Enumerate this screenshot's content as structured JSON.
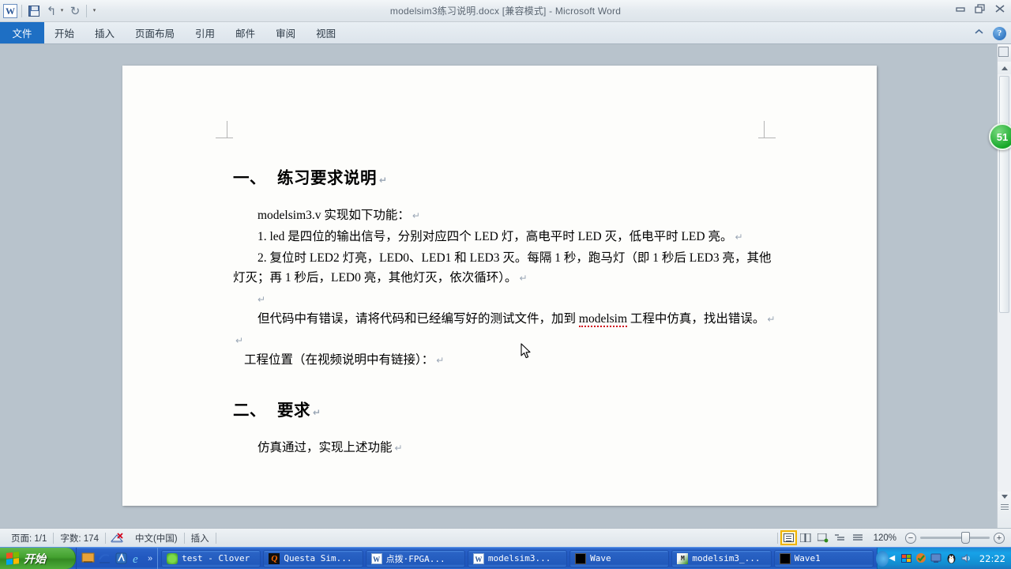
{
  "window": {
    "title": "modelsim3练习说明.docx [兼容模式]  -  Microsoft Word",
    "app_logo": "word-logo",
    "minimize": "minimize-icon",
    "restore": "restore-icon",
    "close": "close-icon",
    "help": "?",
    "collapse_ribbon": "chevron-up-icon"
  },
  "quick_access": {
    "save": "save-icon",
    "undo": "↰",
    "undo_caret": "▾",
    "redo": "↻",
    "customize_caret": "▾"
  },
  "ribbon": {
    "file_tab": "文件",
    "tabs": [
      {
        "label": "开始"
      },
      {
        "label": "插入"
      },
      {
        "label": "页面布局"
      },
      {
        "label": "引用"
      },
      {
        "label": "邮件"
      },
      {
        "label": "审阅"
      },
      {
        "label": "视图"
      }
    ]
  },
  "document": {
    "heading1_num": "一、",
    "heading1_text": "练习要求说明",
    "para1": "modelsim3.v 实现如下功能：",
    "para2": "1. led 是四位的输出信号，分别对应四个 LED 灯，高电平时 LED 灭，低电平时 LED 亮。",
    "para3": "2. 复位时 LED2 灯亮，LED0、LED1 和 LED3 灭。每隔 1 秒，跑马灯（即 1 秒后 LED3 亮，其他灯灭；再 1 秒后，LED0 亮，其他灯灭，依次循环）。",
    "para4_a": "但代码中有错误，请将代码和已经编写好的测试文件，加到 ",
    "para4_spell": "modelsim",
    "para4_b": " 工程中仿真，找出错误。",
    "para5": "工程位置（在视频说明中有链接）：",
    "heading2_num": "二、",
    "heading2_text": "要求",
    "para6": "仿真通过，实现上述功能",
    "pilcrow": "↵"
  },
  "scrollbar": {
    "badge": "51",
    "up_arrow": "scroll-up-icon",
    "down_arrow": "scroll-down-icon"
  },
  "statusbar": {
    "page": "页面: 1/1",
    "words": "字数: 174",
    "proofing": "proofing-errors-icon",
    "language": "中文(中国)",
    "insert_mode": "插入",
    "views": [
      {
        "name": "print-layout",
        "active": true
      },
      {
        "name": "full-screen-reading",
        "active": false
      },
      {
        "name": "web-layout",
        "active": false
      },
      {
        "name": "outline",
        "active": false
      },
      {
        "name": "draft",
        "active": false
      }
    ],
    "zoom": "120%",
    "zoom_out": "−",
    "zoom_in": "+"
  },
  "taskbar": {
    "start": "开始",
    "quick_launch": [
      {
        "name": "show-desktop-icon"
      },
      {
        "name": "media-player-icon"
      },
      {
        "name": "internet-explorer-icon"
      },
      {
        "name": "more-chevron-icon",
        "label": "»"
      }
    ],
    "tasks": [
      {
        "label": "test - Clover",
        "icon": "clover"
      },
      {
        "label": "Questa Sim...",
        "icon": "questa"
      },
      {
        "label": "点拨·FPGA...",
        "icon": "word"
      },
      {
        "label": "modelsim3...",
        "icon": "word"
      },
      {
        "label": "Wave",
        "icon": "black"
      },
      {
        "label": "modelsim3_...",
        "icon": "msim"
      },
      {
        "label": "Wave1",
        "icon": "black"
      }
    ],
    "tray_chevron": "◀",
    "tray_icons": [
      {
        "name": "network-icon"
      },
      {
        "name": "antivirus-icon"
      },
      {
        "name": "display-icon"
      },
      {
        "name": "qq-penguin-icon"
      },
      {
        "name": "volume-icon"
      }
    ],
    "clock": "22:22"
  }
}
